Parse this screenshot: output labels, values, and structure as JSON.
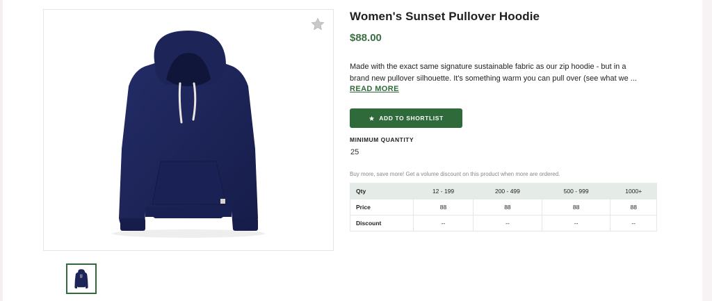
{
  "product": {
    "title": "Women's Sunset Pullover Hoodie",
    "price": "$88.00",
    "description_line1": "Made with the exact same signature sustainable fabric as our zip hoodie - but in a",
    "description_line2": "brand new pullover silhouette. It's something warm you can pull over (see what we ...",
    "read_more": "READ MORE",
    "shortlist_button": "ADD TO SHORTLIST",
    "min_qty_label": "MINIMUM QUANTITY",
    "min_qty_value": "25",
    "discount_note": "Buy more, save more! Get a volume discount on this product when more are ordered."
  },
  "pricing_table": {
    "header": [
      "Qty",
      "12 - 199",
      "200 - 499",
      "500 - 999",
      "1000+"
    ],
    "rows": [
      [
        "Price",
        "88",
        "88",
        "88",
        "88"
      ],
      [
        "Discount",
        "--",
        "--",
        "--",
        "--"
      ]
    ]
  },
  "colors": {
    "accent": "#2f6b3a",
    "price": "#3b7044",
    "hoodie": "#1d2558",
    "table_header": "#e5ebe7"
  },
  "icons": {
    "favorite": "star-icon",
    "button": "star-icon"
  }
}
